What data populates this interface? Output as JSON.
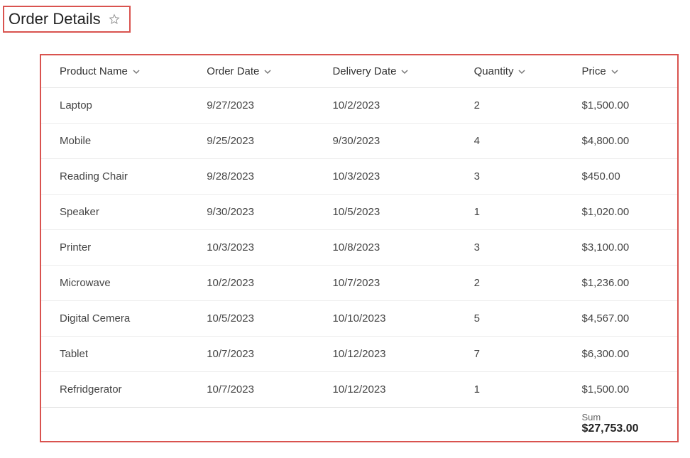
{
  "page": {
    "title": "Order Details"
  },
  "table": {
    "columns": [
      {
        "key": "product",
        "label": "Product Name"
      },
      {
        "key": "orderDate",
        "label": "Order Date"
      },
      {
        "key": "deliveryDate",
        "label": "Delivery Date"
      },
      {
        "key": "quantity",
        "label": "Quantity"
      },
      {
        "key": "price",
        "label": "Price"
      }
    ],
    "rows": [
      {
        "product": "Laptop",
        "orderDate": "9/27/2023",
        "deliveryDate": "10/2/2023",
        "quantity": "2",
        "price": "$1,500.00"
      },
      {
        "product": "Mobile",
        "orderDate": "9/25/2023",
        "deliveryDate": "9/30/2023",
        "quantity": "4",
        "price": "$4,800.00"
      },
      {
        "product": "Reading Chair",
        "orderDate": "9/28/2023",
        "deliveryDate": "10/3/2023",
        "quantity": "3",
        "price": "$450.00"
      },
      {
        "product": "Speaker",
        "orderDate": "9/30/2023",
        "deliveryDate": "10/5/2023",
        "quantity": "1",
        "price": "$1,020.00"
      },
      {
        "product": "Printer",
        "orderDate": "10/3/2023",
        "deliveryDate": "10/8/2023",
        "quantity": "3",
        "price": "$3,100.00"
      },
      {
        "product": "Microwave",
        "orderDate": "10/2/2023",
        "deliveryDate": "10/7/2023",
        "quantity": "2",
        "price": "$1,236.00"
      },
      {
        "product": "Digital Cemera",
        "orderDate": "10/5/2023",
        "deliveryDate": "10/10/2023",
        "quantity": "5",
        "price": "$4,567.00"
      },
      {
        "product": "Tablet",
        "orderDate": "10/7/2023",
        "deliveryDate": "10/12/2023",
        "quantity": "7",
        "price": "$6,300.00"
      },
      {
        "product": "Refridgerator",
        "orderDate": "10/7/2023",
        "deliveryDate": "10/12/2023",
        "quantity": "1",
        "price": "$1,500.00"
      }
    ],
    "footer": {
      "sumLabel": "Sum",
      "sumValue": "$27,753.00"
    }
  }
}
